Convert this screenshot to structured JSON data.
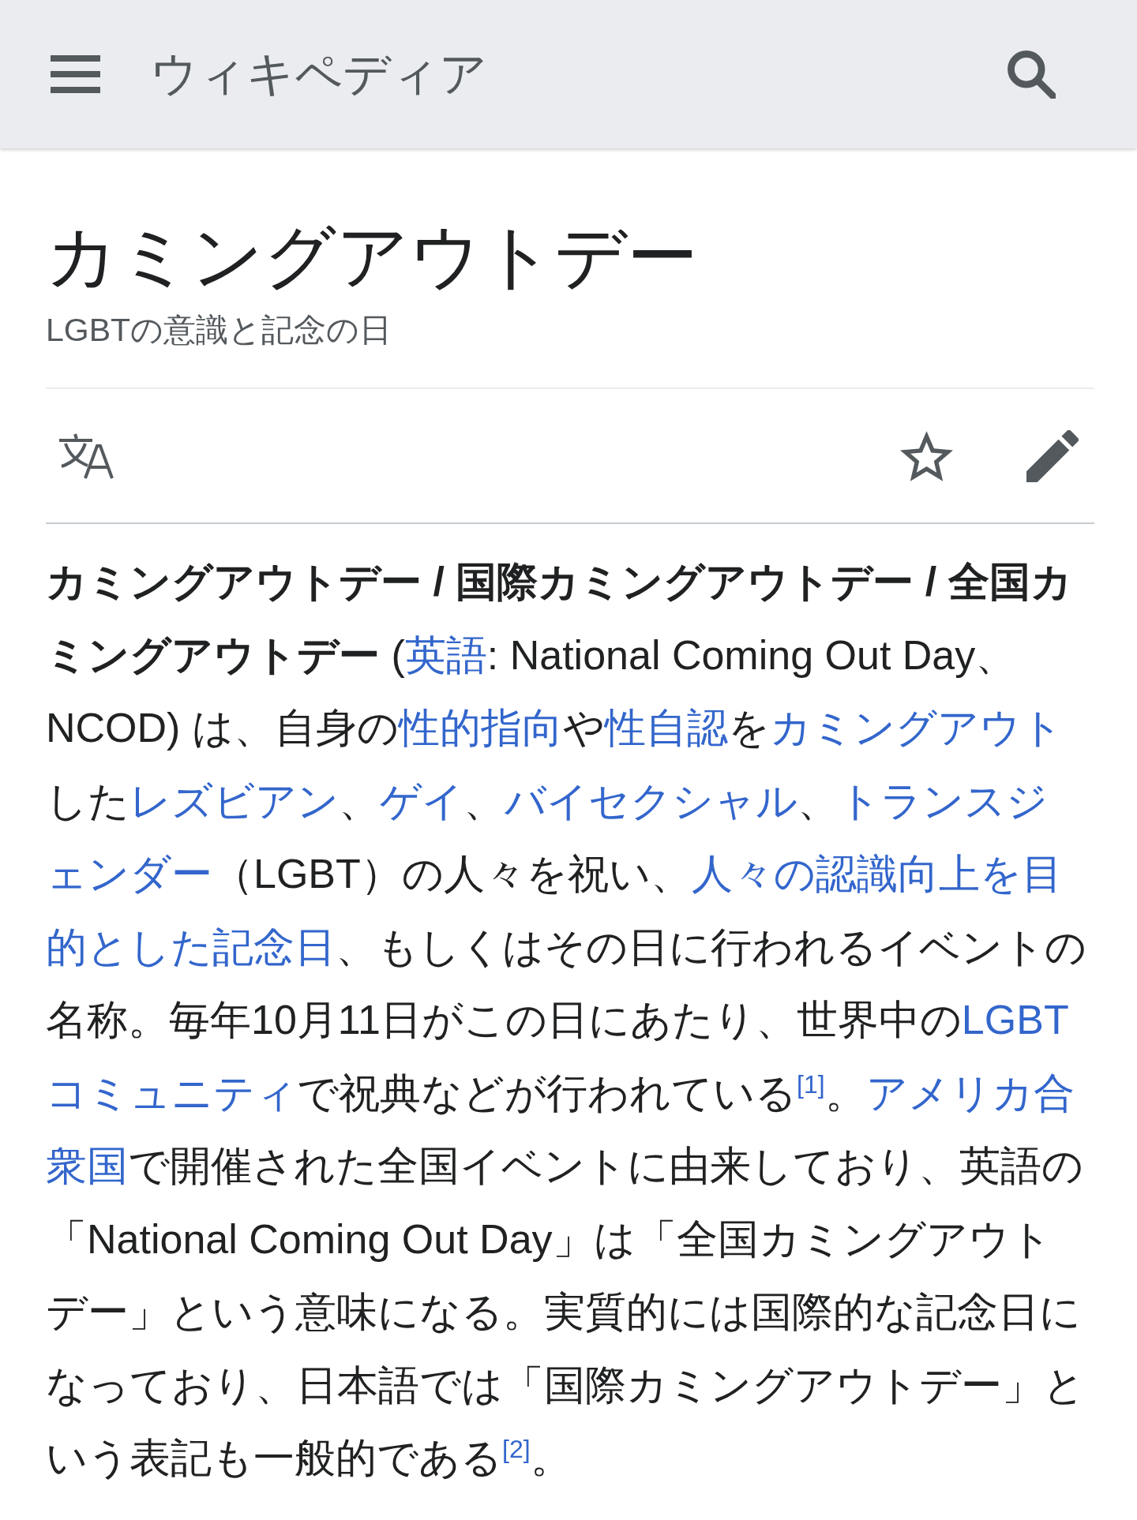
{
  "header": {
    "logo": "ウィキペディア"
  },
  "article": {
    "title": "カミングアウトデー",
    "description": "LGBTの意識と記念の日"
  },
  "paragraph": {
    "lines": [
      [
        {
          "kind": "bold",
          "text": "カミングアウトデー / 国際カミングアウトデー / 全国カ"
        }
      ],
      [
        {
          "kind": "bold",
          "text": "ミングアウトデー"
        },
        {
          "kind": "text",
          "text": " ("
        },
        {
          "kind": "link",
          "text": "英語"
        },
        {
          "kind": "text",
          "text": ": National Coming Out Day、"
        }
      ],
      [
        {
          "kind": "text",
          "text": "NCOD) は、自身の"
        },
        {
          "kind": "link",
          "text": "性的指向"
        },
        {
          "kind": "text",
          "text": "や"
        },
        {
          "kind": "link",
          "text": "性自認"
        },
        {
          "kind": "text",
          "text": "を"
        },
        {
          "kind": "link",
          "text": "カミングアウト"
        }
      ],
      [
        {
          "kind": "text",
          "text": "した"
        },
        {
          "kind": "link",
          "text": "レズビアン"
        },
        {
          "kind": "text",
          "text": "、"
        },
        {
          "kind": "link",
          "text": "ゲイ"
        },
        {
          "kind": "text",
          "text": "、"
        },
        {
          "kind": "link",
          "text": "バイセクシャル"
        },
        {
          "kind": "text",
          "text": "、"
        },
        {
          "kind": "link",
          "text": "トランスジ"
        }
      ],
      [
        {
          "kind": "link",
          "text": "ェンダー"
        },
        {
          "kind": "text",
          "text": "（LGBT）の人々を祝い、"
        },
        {
          "kind": "link",
          "text": "人々の認識向上を目"
        }
      ],
      [
        {
          "kind": "link",
          "text": "的とした記念日"
        },
        {
          "kind": "text",
          "text": "、もしくはその日に行われるイベントの"
        }
      ],
      [
        {
          "kind": "text",
          "text": "名称。毎年10月11日がこの日にあたり、世界中の"
        },
        {
          "kind": "link",
          "text": "LGBT"
        }
      ],
      [
        {
          "kind": "link",
          "text": "コミュニティ"
        },
        {
          "kind": "text",
          "text": "で祝典などが行われている"
        },
        {
          "kind": "ref",
          "text": "[1]"
        },
        {
          "kind": "text",
          "text": "。"
        },
        {
          "kind": "link",
          "text": "アメリカ合"
        }
      ],
      [
        {
          "kind": "link",
          "text": "衆国"
        },
        {
          "kind": "text",
          "text": "で開催された全国イベントに由来しており、英語の"
        }
      ],
      [
        {
          "kind": "text",
          "text": "「National Coming Out Day」は「全国カミングアウト"
        }
      ],
      [
        {
          "kind": "text",
          "text": "デー」という意味になる。実質的には国際的な記念日に"
        }
      ],
      [
        {
          "kind": "text",
          "text": "なっており、日本語では「国際カミングアウトデー」と"
        }
      ],
      [
        {
          "kind": "text",
          "text": "いう表記も一般的である"
        },
        {
          "kind": "ref",
          "text": "[2]"
        },
        {
          "kind": "text",
          "text": "。"
        }
      ]
    ]
  }
}
